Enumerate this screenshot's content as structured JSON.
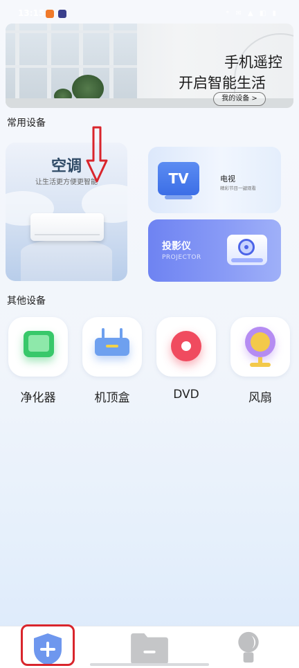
{
  "status_bar": {
    "time": "13:15",
    "right_indicators": "* ✉ ▲ ◧ ▮"
  },
  "banner": {
    "title_line1": "手机遥控",
    "title_line2": "开启智能生活",
    "my_devices_button": "我的设备 >"
  },
  "common_section": {
    "title": "常用设备"
  },
  "aircon_card": {
    "title": "空调",
    "subtitle": "让生活更方便更智能"
  },
  "tv_card": {
    "icon_text": "TV",
    "title": "电视",
    "subtitle": "精彩节目一键观看"
  },
  "projector_card": {
    "title": "投影仪",
    "subtitle": "PROJECTOR"
  },
  "other_section": {
    "title": "其他设备"
  },
  "other_devices": [
    {
      "label": "净化器",
      "icon": "air-purifier-icon"
    },
    {
      "label": "机顶盒",
      "icon": "set-top-box-icon"
    },
    {
      "label": "DVD",
      "icon": "dvd-disc-icon"
    },
    {
      "label": "风扇",
      "icon": "fan-icon"
    }
  ],
  "tabbar": {
    "tabs": [
      {
        "icon": "add-shield-icon",
        "active": true
      },
      {
        "icon": "folder-minus-icon",
        "active": false
      },
      {
        "icon": "profile-icon",
        "active": false
      }
    ]
  },
  "colors": {
    "accent_blue": "#5b8cf2",
    "projector_purple": "#7b8ef3",
    "annotation_red": "#d9252c",
    "text_dark": "#222222"
  }
}
